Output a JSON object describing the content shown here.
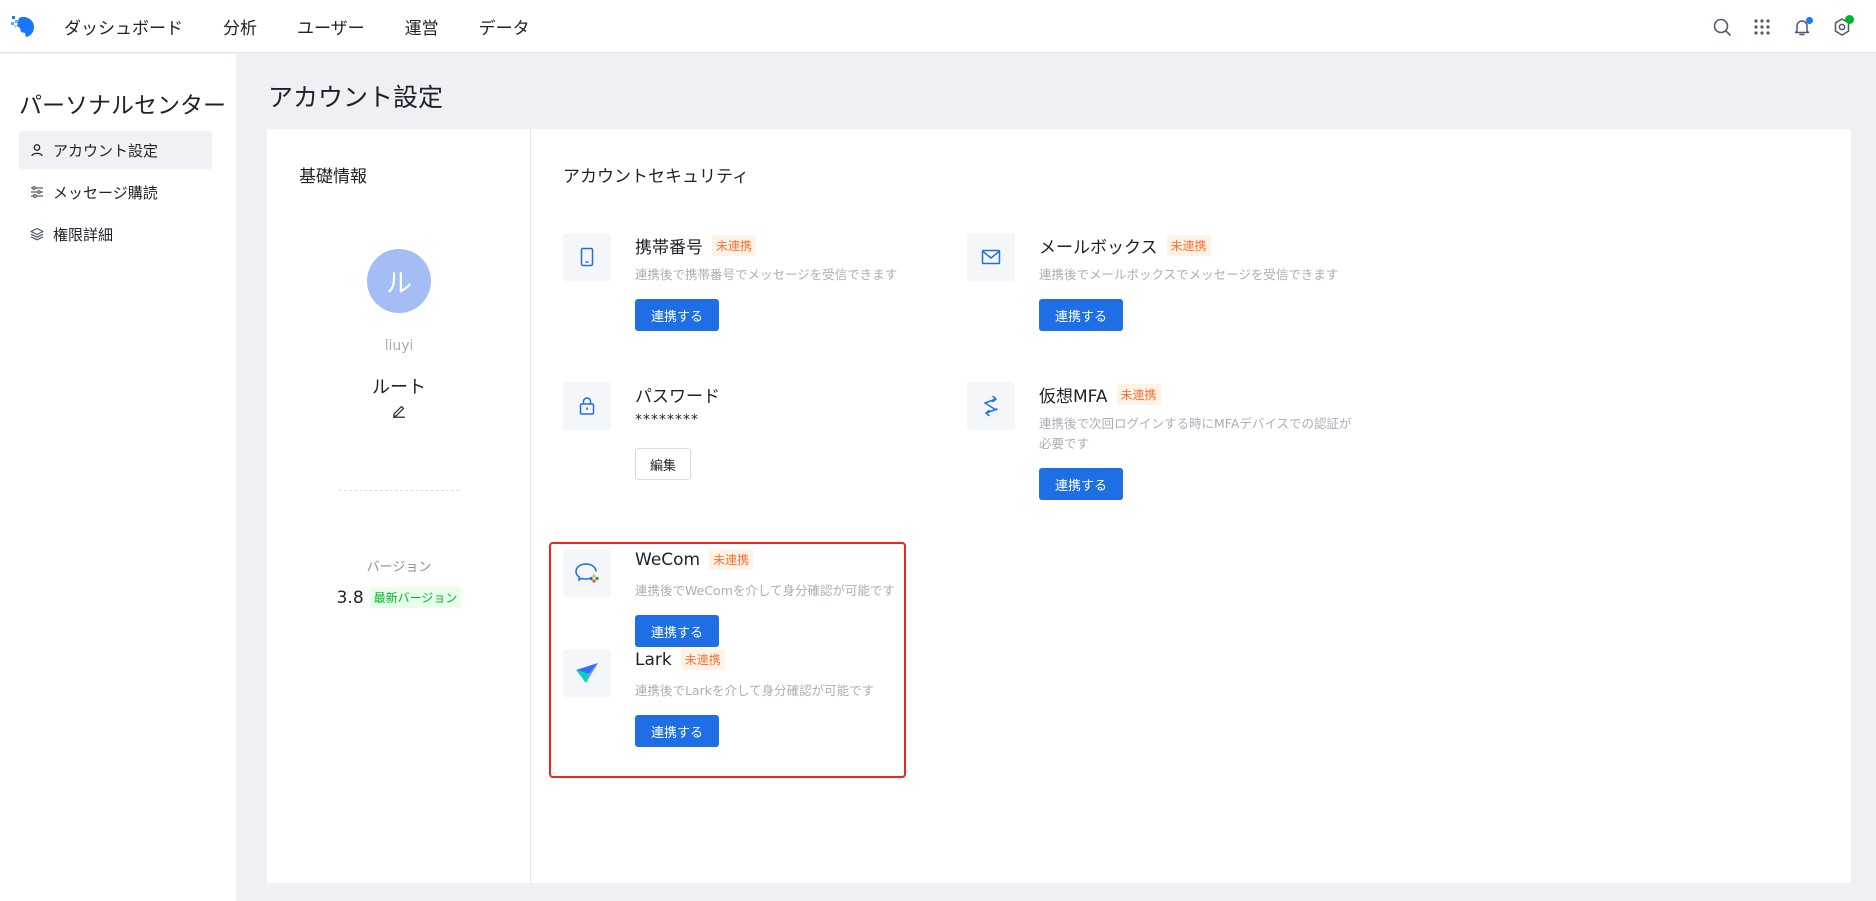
{
  "nav": {
    "items": [
      "ダッシュボード",
      "分析",
      "ユーザー",
      "運営",
      "データ"
    ]
  },
  "top_icons": [
    "search-icon",
    "apps-grid-icon",
    "bell-icon",
    "settings-icon"
  ],
  "sidebar": {
    "title": "パーソナルセンター",
    "items": [
      {
        "label": "アカウント設定",
        "icon": "user-icon",
        "active": true
      },
      {
        "label": "メッセージ購読",
        "icon": "sliders-icon",
        "active": false
      },
      {
        "label": "権限詳細",
        "icon": "layers-icon",
        "active": false
      }
    ]
  },
  "main": {
    "title": "アカウント設定",
    "basic": {
      "title": "基礎情報",
      "avatar_letter": "ル",
      "username": "liuyi",
      "role": "ルート",
      "version_label": "バージョン",
      "version": "3.8",
      "version_tag": "最新バージョン"
    },
    "security": {
      "title": "アカウントセキュリティ",
      "items": [
        {
          "name": "携帯番号",
          "badge": "未連携",
          "desc": "連携後で携帯番号でメッセージを受信できます",
          "button": "連携する",
          "icon": "mobile-icon"
        },
        {
          "name": "メールボックス",
          "badge": "未連携",
          "desc": "連携後でメールボックスでメッセージを受信できます",
          "button": "連携する",
          "icon": "mail-icon"
        },
        {
          "name": "パスワード",
          "value": "********",
          "button": "編集",
          "icon": "lock-icon"
        },
        {
          "name": "仮想MFA",
          "badge": "未連携",
          "desc": "連携後で次回ログインする時にMFAデバイスでの認証が必要です",
          "button": "連携する",
          "icon": "sync-icon"
        },
        {
          "name": "WeCom",
          "badge": "未連携",
          "desc": "連携後でWeComを介して身分確認が可能です",
          "button": "連携する",
          "icon": "wecom-icon"
        },
        {
          "name": "Lark",
          "badge": "未連携",
          "desc": "連携後でLarkを介して身分確認が可能です",
          "button": "連携する",
          "icon": "lark-icon"
        }
      ]
    }
  },
  "colors": {
    "primary": "#1e6fe6",
    "badge_text": "#f77234",
    "highlight": "#f2221c",
    "success": "#00b42a"
  }
}
